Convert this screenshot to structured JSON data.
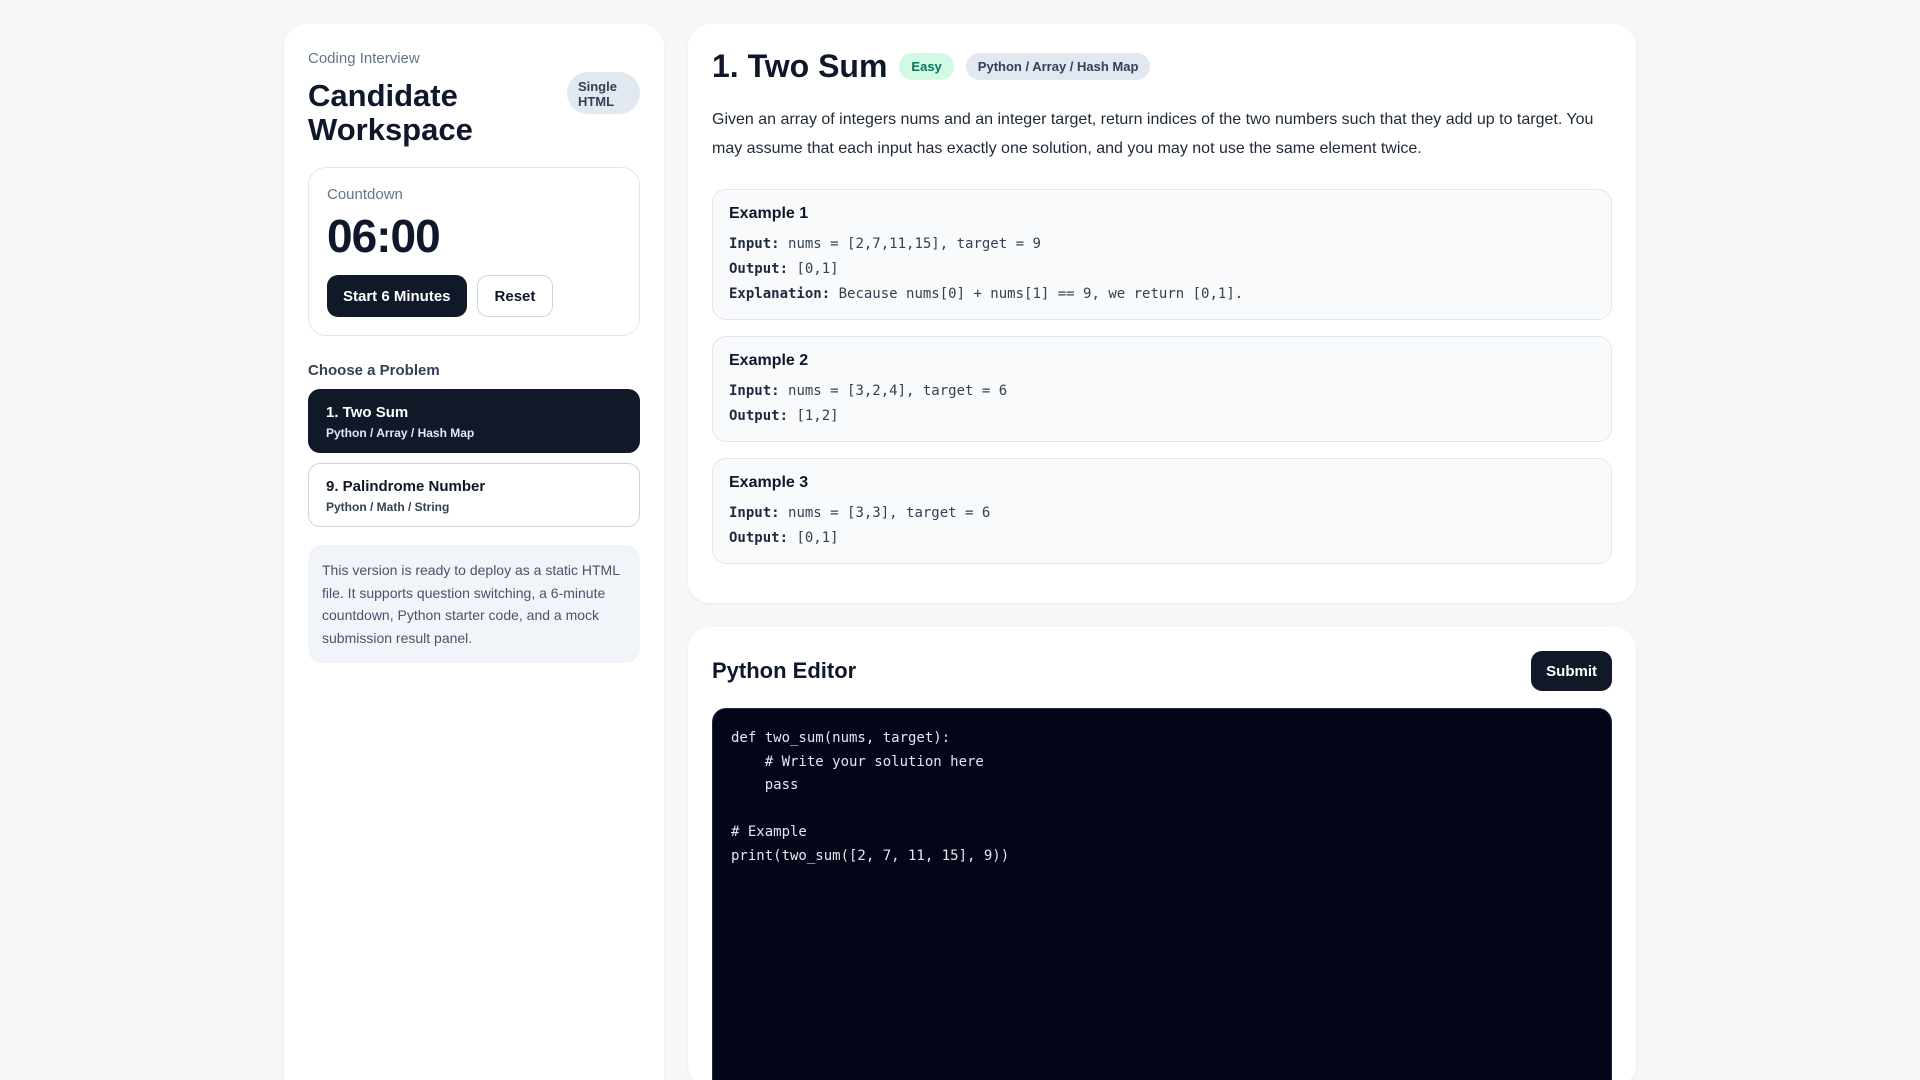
{
  "sidebar": {
    "eyebrow": "Coding Interview",
    "title": "Candidate Workspace",
    "badge": "Single HTML",
    "timer": {
      "label": "Countdown",
      "value": "06:00",
      "start_label": "Start 6 Minutes",
      "reset_label": "Reset"
    },
    "problems_heading": "Choose a Problem",
    "problems": [
      {
        "title": "1. Two Sum",
        "tags": "Python / Array / Hash Map",
        "active": true
      },
      {
        "title": "9. Palindrome Number",
        "tags": "Python / Math / String",
        "active": false
      }
    ],
    "note": "This version is ready to deploy as a static HTML file. It supports question switching, a 6-minute countdown, Python starter code, and a mock submission result panel."
  },
  "problem": {
    "title": "1. Two Sum",
    "difficulty": "Easy",
    "tags": "Python / Array / Hash Map",
    "description": "Given an array of integers nums and an integer target, return indices of the two numbers such that they add up to target. You may assume that each input has exactly one solution, and you may not use the same element twice.",
    "examples": [
      {
        "title": "Example 1",
        "input_label": "Input:",
        "input": "nums = [2,7,11,15], target = 9",
        "output_label": "Output:",
        "output": "[0,1]",
        "explanation_label": "Explanation:",
        "explanation": "Because nums[0] + nums[1] == 9, we return [0,1]."
      },
      {
        "title": "Example 2",
        "input_label": "Input:",
        "input": "nums = [3,2,4], target = 6",
        "output_label": "Output:",
        "output": "[1,2]"
      },
      {
        "title": "Example 3",
        "input_label": "Input:",
        "input": "nums = [3,3], target = 6",
        "output_label": "Output:",
        "output": "[0,1]"
      }
    ]
  },
  "editor": {
    "title": "Python Editor",
    "submit_label": "Submit",
    "code": "def two_sum(nums, target):\n    # Write your solution here\n    pass\n\n# Example\nprint(two_sum([2, 7, 11, 15], 9))"
  },
  "colors": {
    "accent_dark": "#111827",
    "easy_bg": "#d1fae5",
    "easy_text": "#047857",
    "code_bg": "#020617"
  }
}
